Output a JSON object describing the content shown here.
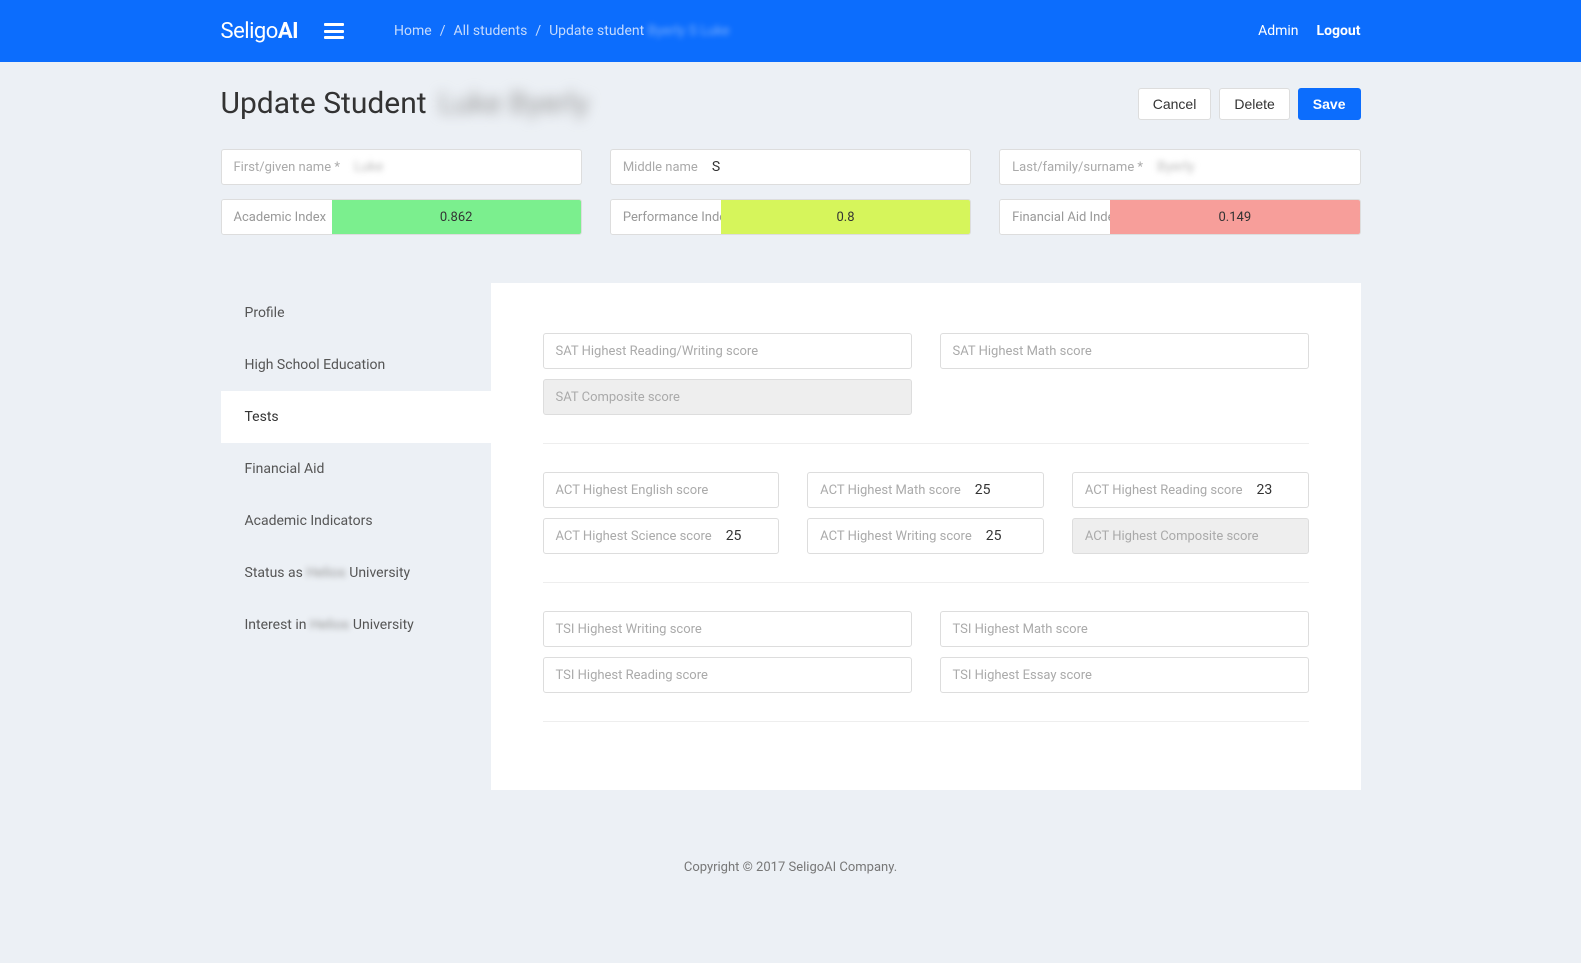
{
  "header": {
    "logo_prefix": "Seligo",
    "logo_suffix": "AI",
    "breadcrumb": {
      "home": "Home",
      "all_students": "All students",
      "update_student": "Update student",
      "student_name_muted": "Byerly S Luke"
    },
    "admin": "Admin",
    "logout": "Logout"
  },
  "title": {
    "text": "Update Student",
    "name_blur": "Luke Byerly"
  },
  "actions": {
    "cancel": "Cancel",
    "delete": "Delete",
    "save": "Save"
  },
  "name_fields": {
    "first_label": "First/given name *",
    "first_value": "Luke",
    "middle_label": "Middle name",
    "middle_value": "S",
    "last_label": "Last/family/surname *",
    "last_value": "Byerly"
  },
  "indices": {
    "academic_label": "Academic Index",
    "academic_value": "0.862",
    "perf_label": "Performance Index",
    "perf_value": "0.8",
    "fin_label": "Financial Aid Index",
    "fin_value": "0.149",
    "colors": {
      "green": "#7bef8e",
      "lime": "#d6f55b",
      "red": "#f79e9a"
    }
  },
  "sidebar": {
    "items": [
      {
        "label": "Profile"
      },
      {
        "label": "High School Education"
      },
      {
        "label": "Tests",
        "active": true
      },
      {
        "label": "Financial Aid"
      },
      {
        "label": "Academic Indicators"
      },
      {
        "label_prefix": "Status as ",
        "label_blur": "Helios",
        "label_suffix": " University"
      },
      {
        "label_prefix": "Interest in ",
        "label_blur": "Helios",
        "label_suffix": " University"
      }
    ]
  },
  "tests": {
    "sat_rw": "SAT Highest Reading/Writing score",
    "sat_math": "SAT Highest Math score",
    "sat_comp": "SAT Composite score",
    "act_english": "ACT Highest English score",
    "act_math": "ACT Highest Math score",
    "act_math_val": "25",
    "act_reading": "ACT Highest Reading score",
    "act_reading_val": "23",
    "act_science": "ACT Highest Science score",
    "act_science_val": "25",
    "act_writing": "ACT Highest Writing score",
    "act_writing_val": "25",
    "act_comp": "ACT Highest Composite score",
    "tsi_writing": "TSI Highest Writing score",
    "tsi_math": "TSI Highest Math score",
    "tsi_reading": "TSI Highest Reading score",
    "tsi_essay": "TSI Highest Essay score"
  },
  "footer": "Copyright © 2017 SeligoAI Company."
}
